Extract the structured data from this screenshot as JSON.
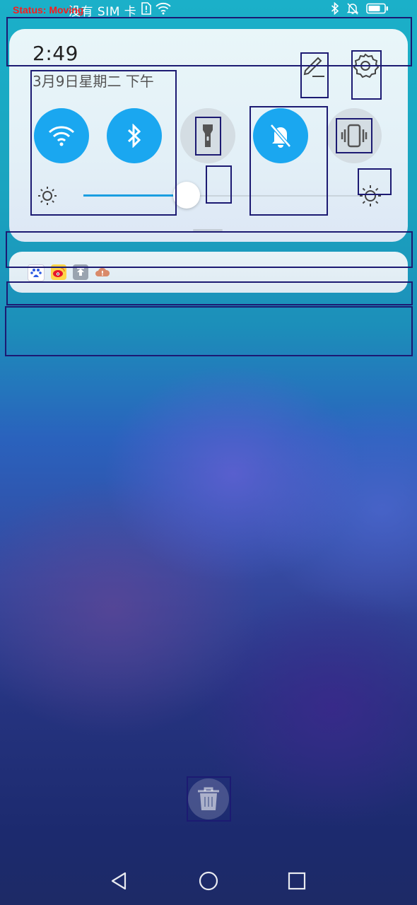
{
  "status_bar": {
    "debug_label": "Status:  Moving",
    "carrier": "没有 SIM 卡",
    "icons": [
      "sim-alert-icon",
      "wifi-icon",
      "bluetooth-icon",
      "mute-icon",
      "battery-icon"
    ]
  },
  "quick_settings": {
    "time": "2:49",
    "date": "3月9日星期二 下午",
    "actions": [
      "edit-icon",
      "settings-icon"
    ],
    "tiles": [
      {
        "name": "wifi",
        "icon": "wifi-icon",
        "state": "on"
      },
      {
        "name": "bluetooth",
        "icon": "bluetooth-icon",
        "state": "on"
      },
      {
        "name": "flashlight",
        "icon": "flashlight-icon",
        "state": "off"
      },
      {
        "name": "silent",
        "icon": "bell-off-icon",
        "state": "on"
      },
      {
        "name": "vibrate",
        "icon": "vibrate-icon",
        "state": "off"
      }
    ],
    "brightness": {
      "level": 0.37,
      "min_icon": "brightness-low-icon",
      "max_icon": "brightness-high-icon"
    }
  },
  "notifications": {
    "app_icons": [
      "baidu-app-icon",
      "weibo-app-icon",
      "upload-app-icon",
      "cloud-app-icon"
    ]
  },
  "clear_all_icon": "trash-icon",
  "navigation": [
    "back-icon",
    "home-icon",
    "recents-icon"
  ],
  "colors": {
    "accent": "#1aa7f0",
    "tile_off": "#d4dde3"
  }
}
